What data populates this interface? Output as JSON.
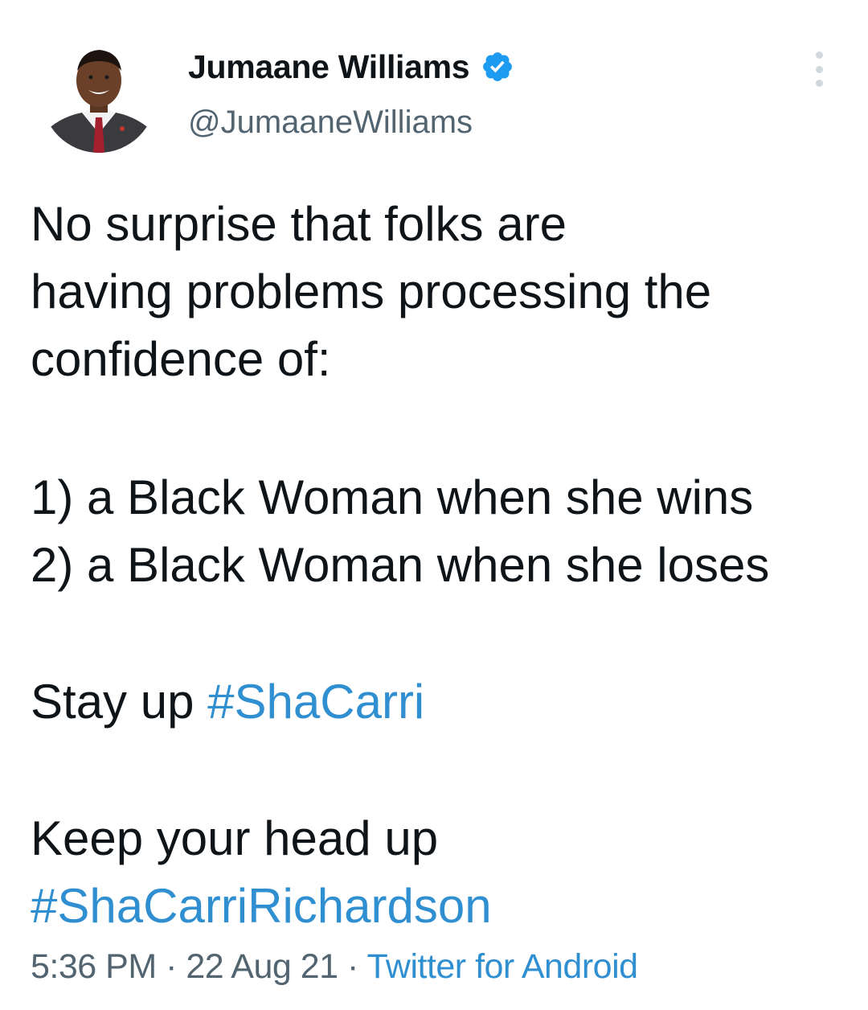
{
  "author": {
    "display_name": "Jumaane Williams",
    "handle": "@JumaaneWilliams",
    "verified": true
  },
  "tweet": {
    "lines": [
      "No surprise that folks are",
      "having problems processing the",
      "confidence of:",
      "1)  a Black Woman when she wins",
      "2) a Black Woman when she loses"
    ],
    "stay_up_text": "Stay up ",
    "hashtag_1": "#ShaCarri",
    "keep_text": "Keep your head up",
    "hashtag_2": "#ShaCarriRichardson"
  },
  "meta": {
    "time": "5:36 PM",
    "separator": " · ",
    "date": "22 Aug 21",
    "source": "Twitter for Android"
  },
  "colors": {
    "link": "#2f8fd0",
    "verified_badge": "#1d9bf0",
    "secondary_text": "#536471"
  },
  "icons": {
    "verified": "verified-badge-icon",
    "more": "more-options-icon"
  }
}
